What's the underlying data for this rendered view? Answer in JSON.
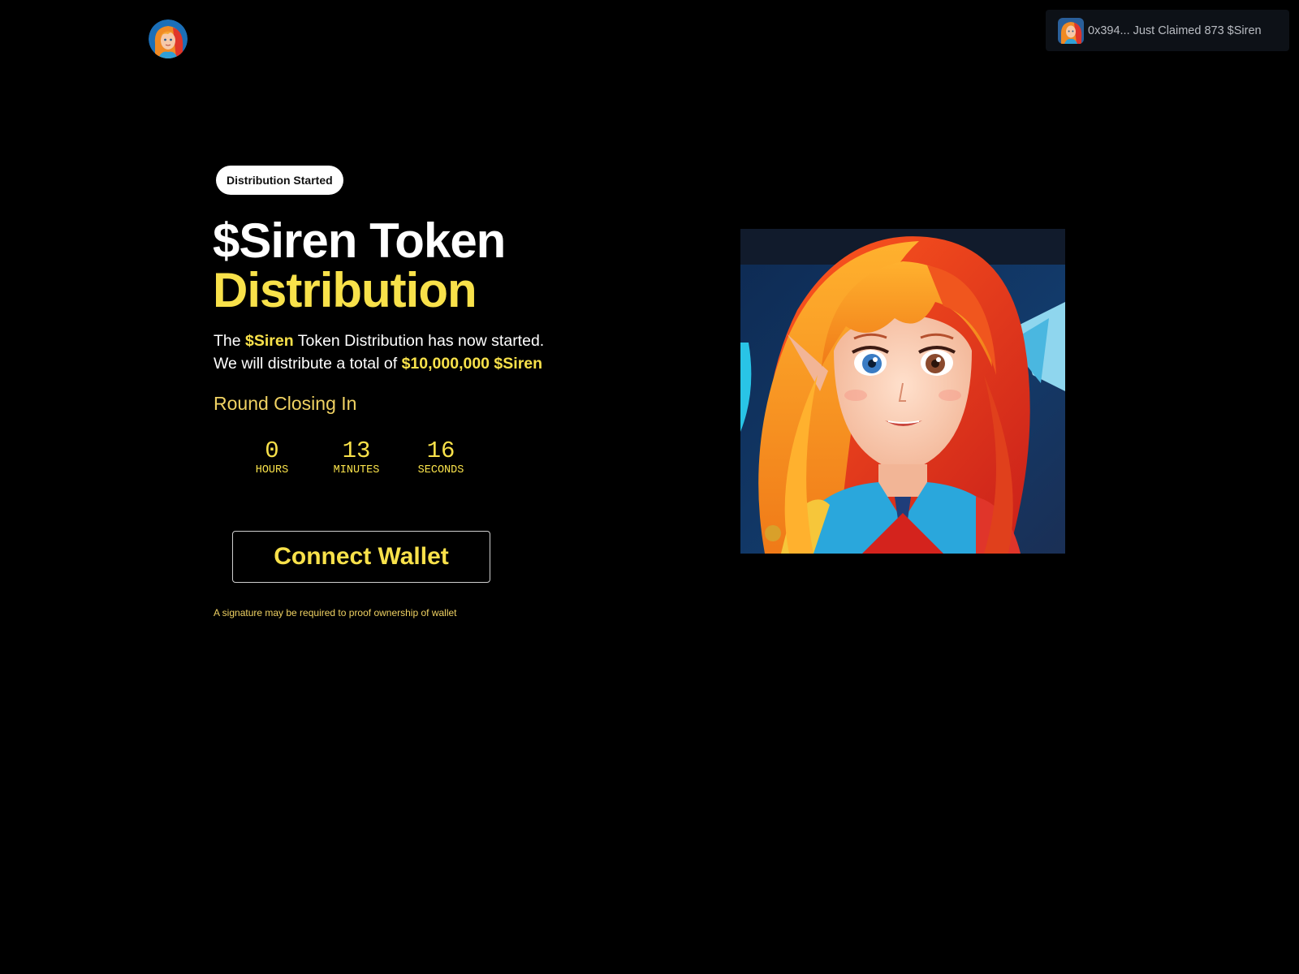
{
  "header": {
    "logo_icon": "siren-avatar-icon"
  },
  "toast": {
    "avatar_icon": "siren-avatar-icon",
    "message": "0x394... Just Claimed 873 $Siren"
  },
  "hero": {
    "badge": "Distribution Started",
    "title_line1": "$Siren Token",
    "title_line2": "Distribution",
    "desc_line1": {
      "pre": "The ",
      "highlight": "$Siren",
      "post": " Token Distribution has now started."
    },
    "desc_line2": {
      "pre": "We will distribute a total of ",
      "highlight": "$10,000,000 $Siren"
    },
    "round_label": "Round Closing In",
    "countdown": [
      {
        "value": "0",
        "label": "HOURS"
      },
      {
        "value": "13",
        "label": "MINUTES"
      },
      {
        "value": "16",
        "label": "SECONDS"
      }
    ],
    "connect_label": "Connect Wallet",
    "signature_note": "A signature may be required to proof ownership of wallet",
    "image_icon": "siren-character-illustration"
  },
  "colors": {
    "background": "#000000",
    "accent_yellow": "#f8e14a",
    "muted_yellow": "#f0d263",
    "toast_bg": "#0d1117",
    "white": "#ffffff"
  }
}
